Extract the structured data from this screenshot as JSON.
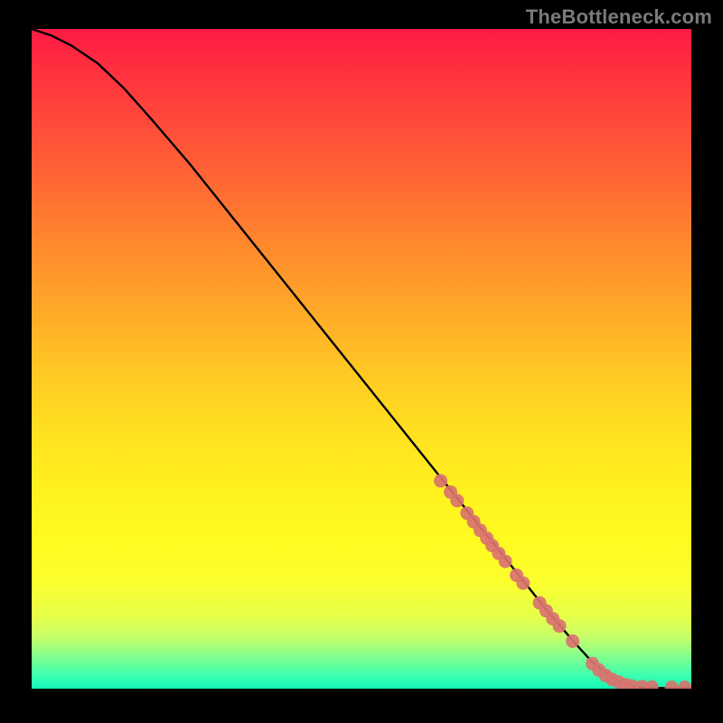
{
  "watermark": "TheBottleneck.com",
  "chart_data": {
    "type": "line",
    "title": "",
    "xlabel": "",
    "ylabel": "",
    "xlim": [
      0,
      100
    ],
    "ylim": [
      0,
      100
    ],
    "grid": false,
    "legend": false,
    "series": [
      {
        "name": "curve",
        "kind": "line",
        "x": [
          0,
          3,
          6,
          10,
          14,
          18,
          24,
          30,
          36,
          42,
          48,
          54,
          60,
          66,
          72,
          78,
          82,
          85,
          88,
          90,
          92,
          95,
          98,
          100
        ],
        "y": [
          100,
          99,
          97.5,
          94.8,
          91,
          86.5,
          79.5,
          72,
          64.5,
          57,
          49.5,
          42,
          34.5,
          27,
          19.5,
          12,
          7.3,
          4,
          1.7,
          0.6,
          0.2,
          0.1,
          0.05,
          0.05
        ]
      },
      {
        "name": "markers",
        "kind": "scatter",
        "x": [
          62,
          63.5,
          64.5,
          66,
          67,
          68,
          69,
          69.8,
          70.8,
          71.8,
          73.5,
          74.5,
          77,
          78,
          79,
          80,
          82,
          85,
          86,
          87,
          88,
          89,
          90,
          91,
          92.5,
          94,
          97,
          99
        ],
        "y": [
          31.5,
          29.8,
          28.5,
          26.6,
          25.3,
          24.0,
          22.8,
          21.7,
          20.5,
          19.3,
          17.2,
          16.0,
          13.0,
          11.8,
          10.6,
          9.5,
          7.2,
          3.8,
          2.8,
          2.0,
          1.4,
          1.0,
          0.6,
          0.4,
          0.3,
          0.25,
          0.2,
          0.2
        ]
      }
    ]
  }
}
